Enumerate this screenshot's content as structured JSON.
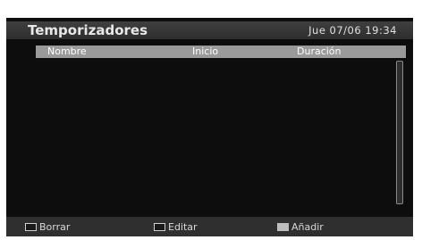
{
  "header": {
    "title": "Temporizadores",
    "datetime": "Jue 07/06 19:34"
  },
  "table": {
    "columns": [
      "Nombre",
      "Inicio",
      "Duración"
    ],
    "rows": []
  },
  "footer": {
    "buttons": [
      {
        "label": "Borrar",
        "key_style": "outline"
      },
      {
        "label": "Editar",
        "key_style": "outline"
      },
      {
        "label": "Añadir",
        "key_style": "filled"
      }
    ]
  },
  "colors": {
    "screen_background": "#0d0d0d",
    "title_bar": "#3a3a3a",
    "column_header": "#9a9a9a",
    "footer": "#2f2f2f"
  }
}
